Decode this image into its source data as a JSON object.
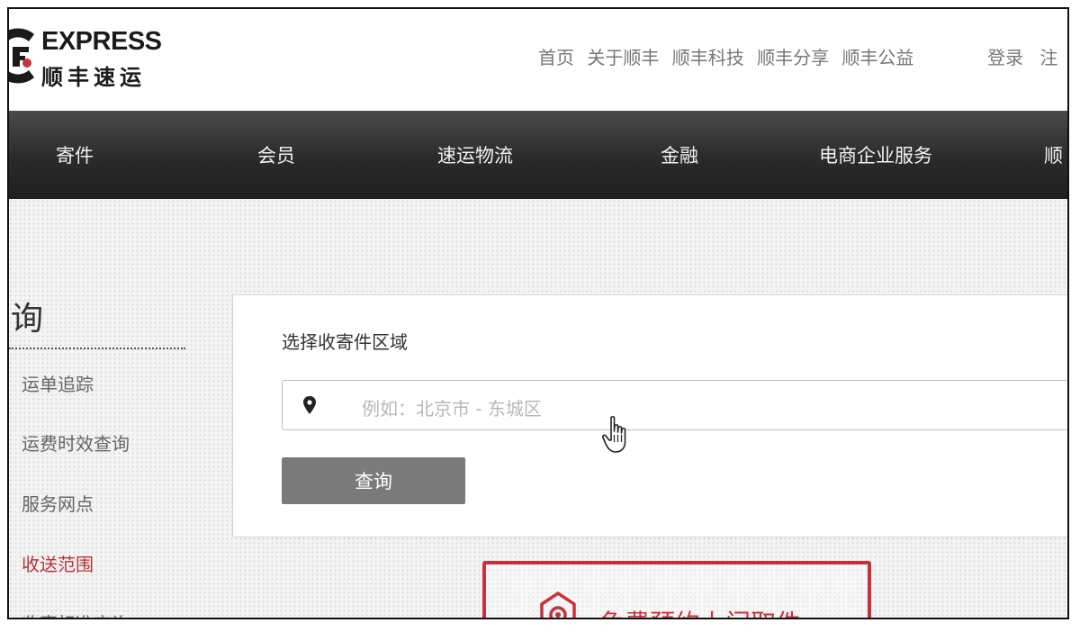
{
  "brand": {
    "name_en": "EXPRESS",
    "name_cn": "顺丰速运"
  },
  "top_nav": [
    "首页",
    "关于顺丰",
    "顺丰科技",
    "顺丰分享",
    "顺丰公益"
  ],
  "auth": {
    "login": "登录",
    "register": "注"
  },
  "main_nav": [
    "寄件",
    "会员",
    "速运物流",
    "金融",
    "电商企业服务",
    "顺"
  ],
  "sidebar": {
    "title": "询",
    "items": [
      {
        "label": "运单追踪",
        "active": false
      },
      {
        "label": "运费时效查询",
        "active": false
      },
      {
        "label": "服务网点",
        "active": false
      },
      {
        "label": "收送范围",
        "active": true
      },
      {
        "label": "收寄标准查询",
        "active": false
      }
    ]
  },
  "query_panel": {
    "label": "选择收寄件区域",
    "region_placeholder": "例如：北京市 - 东城区",
    "region_value": "",
    "button": "查询"
  },
  "pickup_banner": {
    "text": "免费预约上门取件"
  },
  "icons": [
    "location-pin-icon",
    "hand-pointer-icon",
    "location-shield-icon"
  ],
  "colors": {
    "accent_red": "#c7313b",
    "nav_dark": "#2a2a2a",
    "button_gray": "#7b7b7b"
  }
}
